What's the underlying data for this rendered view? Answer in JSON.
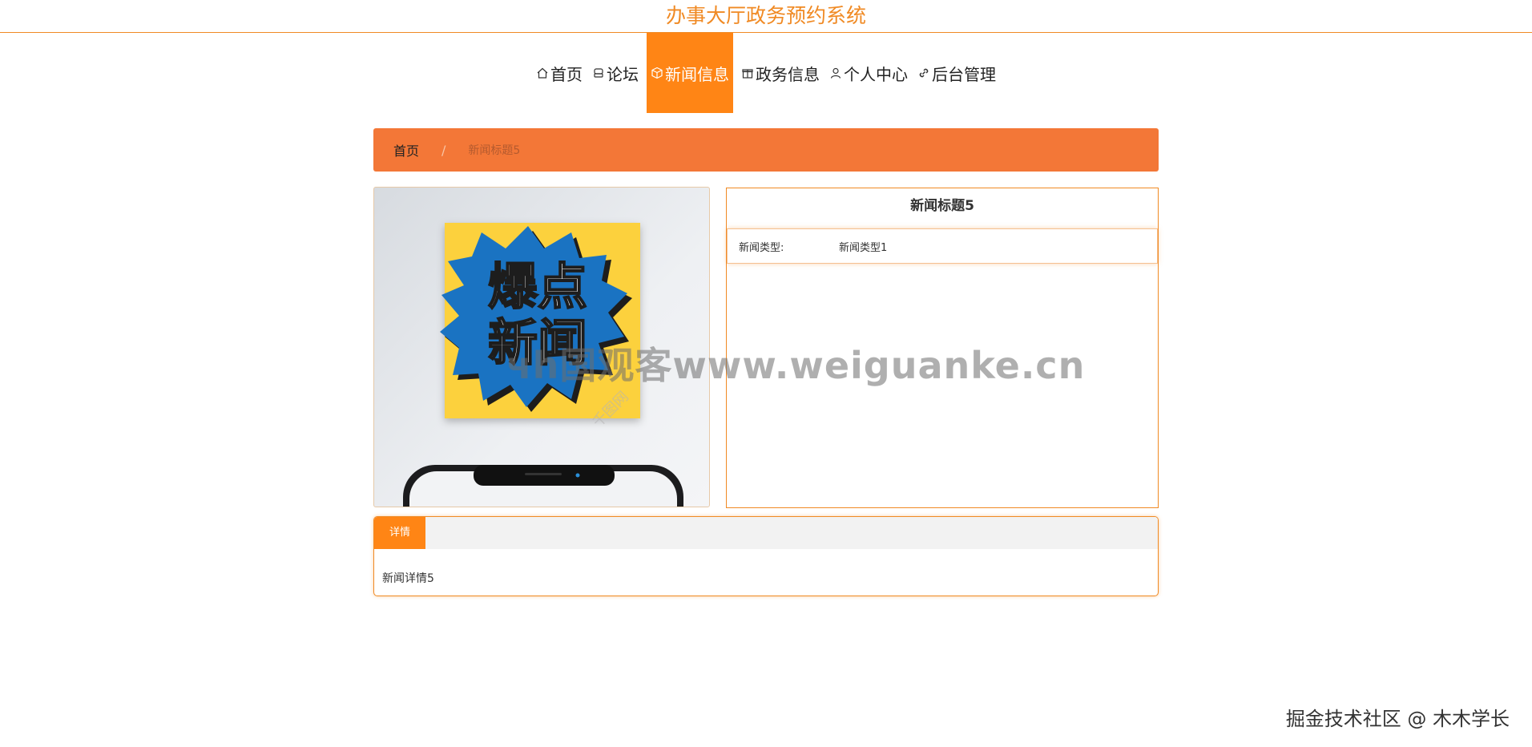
{
  "site": {
    "title": "办事大厅政务预约系统"
  },
  "nav": {
    "items": [
      {
        "label": "首页",
        "icon": "home-icon"
      },
      {
        "label": "论坛",
        "icon": "forum-icon"
      },
      {
        "label": "新闻信息",
        "icon": "cube-icon",
        "active": true
      },
      {
        "label": "政务信息",
        "icon": "gift-icon"
      },
      {
        "label": "个人中心",
        "icon": "user-icon"
      },
      {
        "label": "后台管理",
        "icon": "link-icon"
      }
    ]
  },
  "breadcrumb": {
    "home": "首页",
    "separator": "/",
    "current": "新闻标题5"
  },
  "news": {
    "title": "新闻标题5",
    "type_label": "新闻类型:",
    "type_value": "新闻类型1",
    "image_text_top": "爆点",
    "image_text_bottom": "新闻",
    "image_stamp": "千图网"
  },
  "detail": {
    "tab_label": "详情",
    "content": "新闻详情5"
  },
  "overlay": {
    "watermark": "чh国观客www.weiguanke.cn",
    "footer": "掘金技术社区 @ 木木学长"
  },
  "colors": {
    "accent": "#ff8515",
    "breadcrumb_bg": "#f37737",
    "title_color": "#f08a24"
  }
}
